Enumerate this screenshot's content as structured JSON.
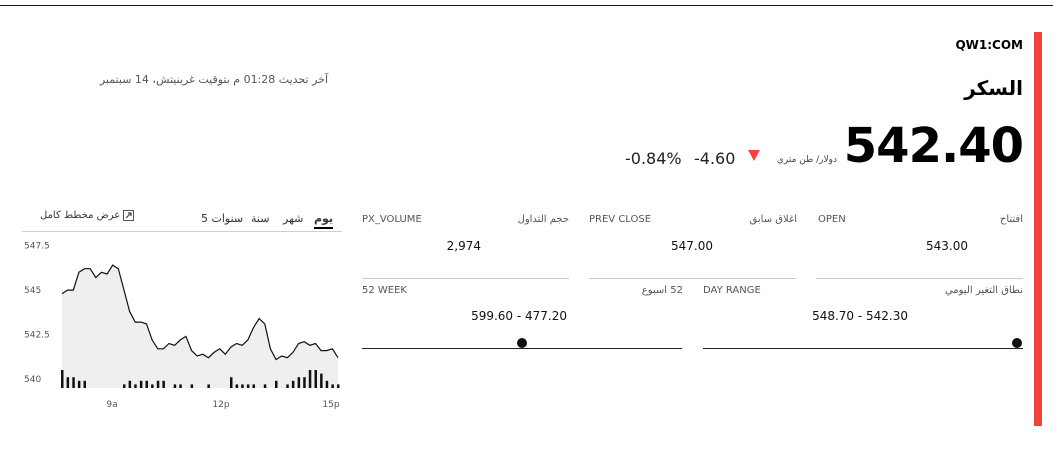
{
  "header": {
    "ticker": "QW1:COM",
    "name": "السكر",
    "updated": "آخر تحديث 01:28 م بتوقيت غرينيتش، 14 سبتمبر"
  },
  "quote": {
    "price": "542.40",
    "unit": "دولار/ طن متري",
    "change": "-4.60",
    "change_pct": "-0.84%",
    "direction": "down",
    "down_color": "#f1423b"
  },
  "stats": {
    "open": {
      "label_ar": "افتتاح",
      "label_en": "OPEN",
      "value": "543.00"
    },
    "prev_close": {
      "label_ar": "اغلاق سابق",
      "label_en": "PREV CLOSE",
      "value": "547.00"
    },
    "volume": {
      "label_ar": "حجم التداول",
      "label_en": "PX_VOLUME",
      "value": "2,974"
    },
    "day_range": {
      "label_ar": "نطاق التغير اليومي",
      "label_en": "DAY RANGE",
      "value": "548.70 - 542.30",
      "position": 0.98
    },
    "week52": {
      "label_ar": "52 اسبوع",
      "label_en": "52 WEEK",
      "value": "599.60 - 477.20",
      "position": 0.5
    }
  },
  "chart_tabs": {
    "day": "يوم",
    "month": "شهر",
    "year": "سنة",
    "five_years": "5 سنوات",
    "active": "day",
    "full_chart": "عرض مخطط كامل",
    "expand_icon": "expand-icon"
  },
  "chart_data": {
    "type": "area",
    "y_ticks": [
      "547.5",
      "545",
      "542.5",
      "540"
    ],
    "x_ticks": [
      "9a",
      "12p",
      "15p"
    ],
    "ylim": [
      539.5,
      547.7
    ],
    "price": [
      544.8,
      545.0,
      545.0,
      546.0,
      546.2,
      546.2,
      545.7,
      546.0,
      545.9,
      546.4,
      546.2,
      545.0,
      543.8,
      543.2,
      543.2,
      543.1,
      542.2,
      541.7,
      541.7,
      542.0,
      541.9,
      542.2,
      542.4,
      541.6,
      541.3,
      541.4,
      541.2,
      541.5,
      541.7,
      541.4,
      541.8,
      542.0,
      541.9,
      542.2,
      542.9,
      543.4,
      543.1,
      541.7,
      541.1,
      541.3,
      541.2,
      541.5,
      542.0,
      542.1,
      541.9,
      542.0,
      541.6,
      541.6,
      541.7,
      541.2
    ],
    "volume": [
      5,
      3,
      3,
      2,
      2,
      0,
      0,
      0,
      0,
      0,
      0,
      1,
      2,
      1,
      2,
      2,
      1,
      2,
      2,
      0,
      1,
      1,
      0,
      1,
      0,
      0,
      1,
      0,
      0,
      0,
      3,
      1,
      1,
      1,
      1,
      0,
      1,
      0,
      2,
      0,
      1,
      2,
      3,
      3,
      5,
      5,
      4,
      2,
      1,
      1
    ]
  }
}
